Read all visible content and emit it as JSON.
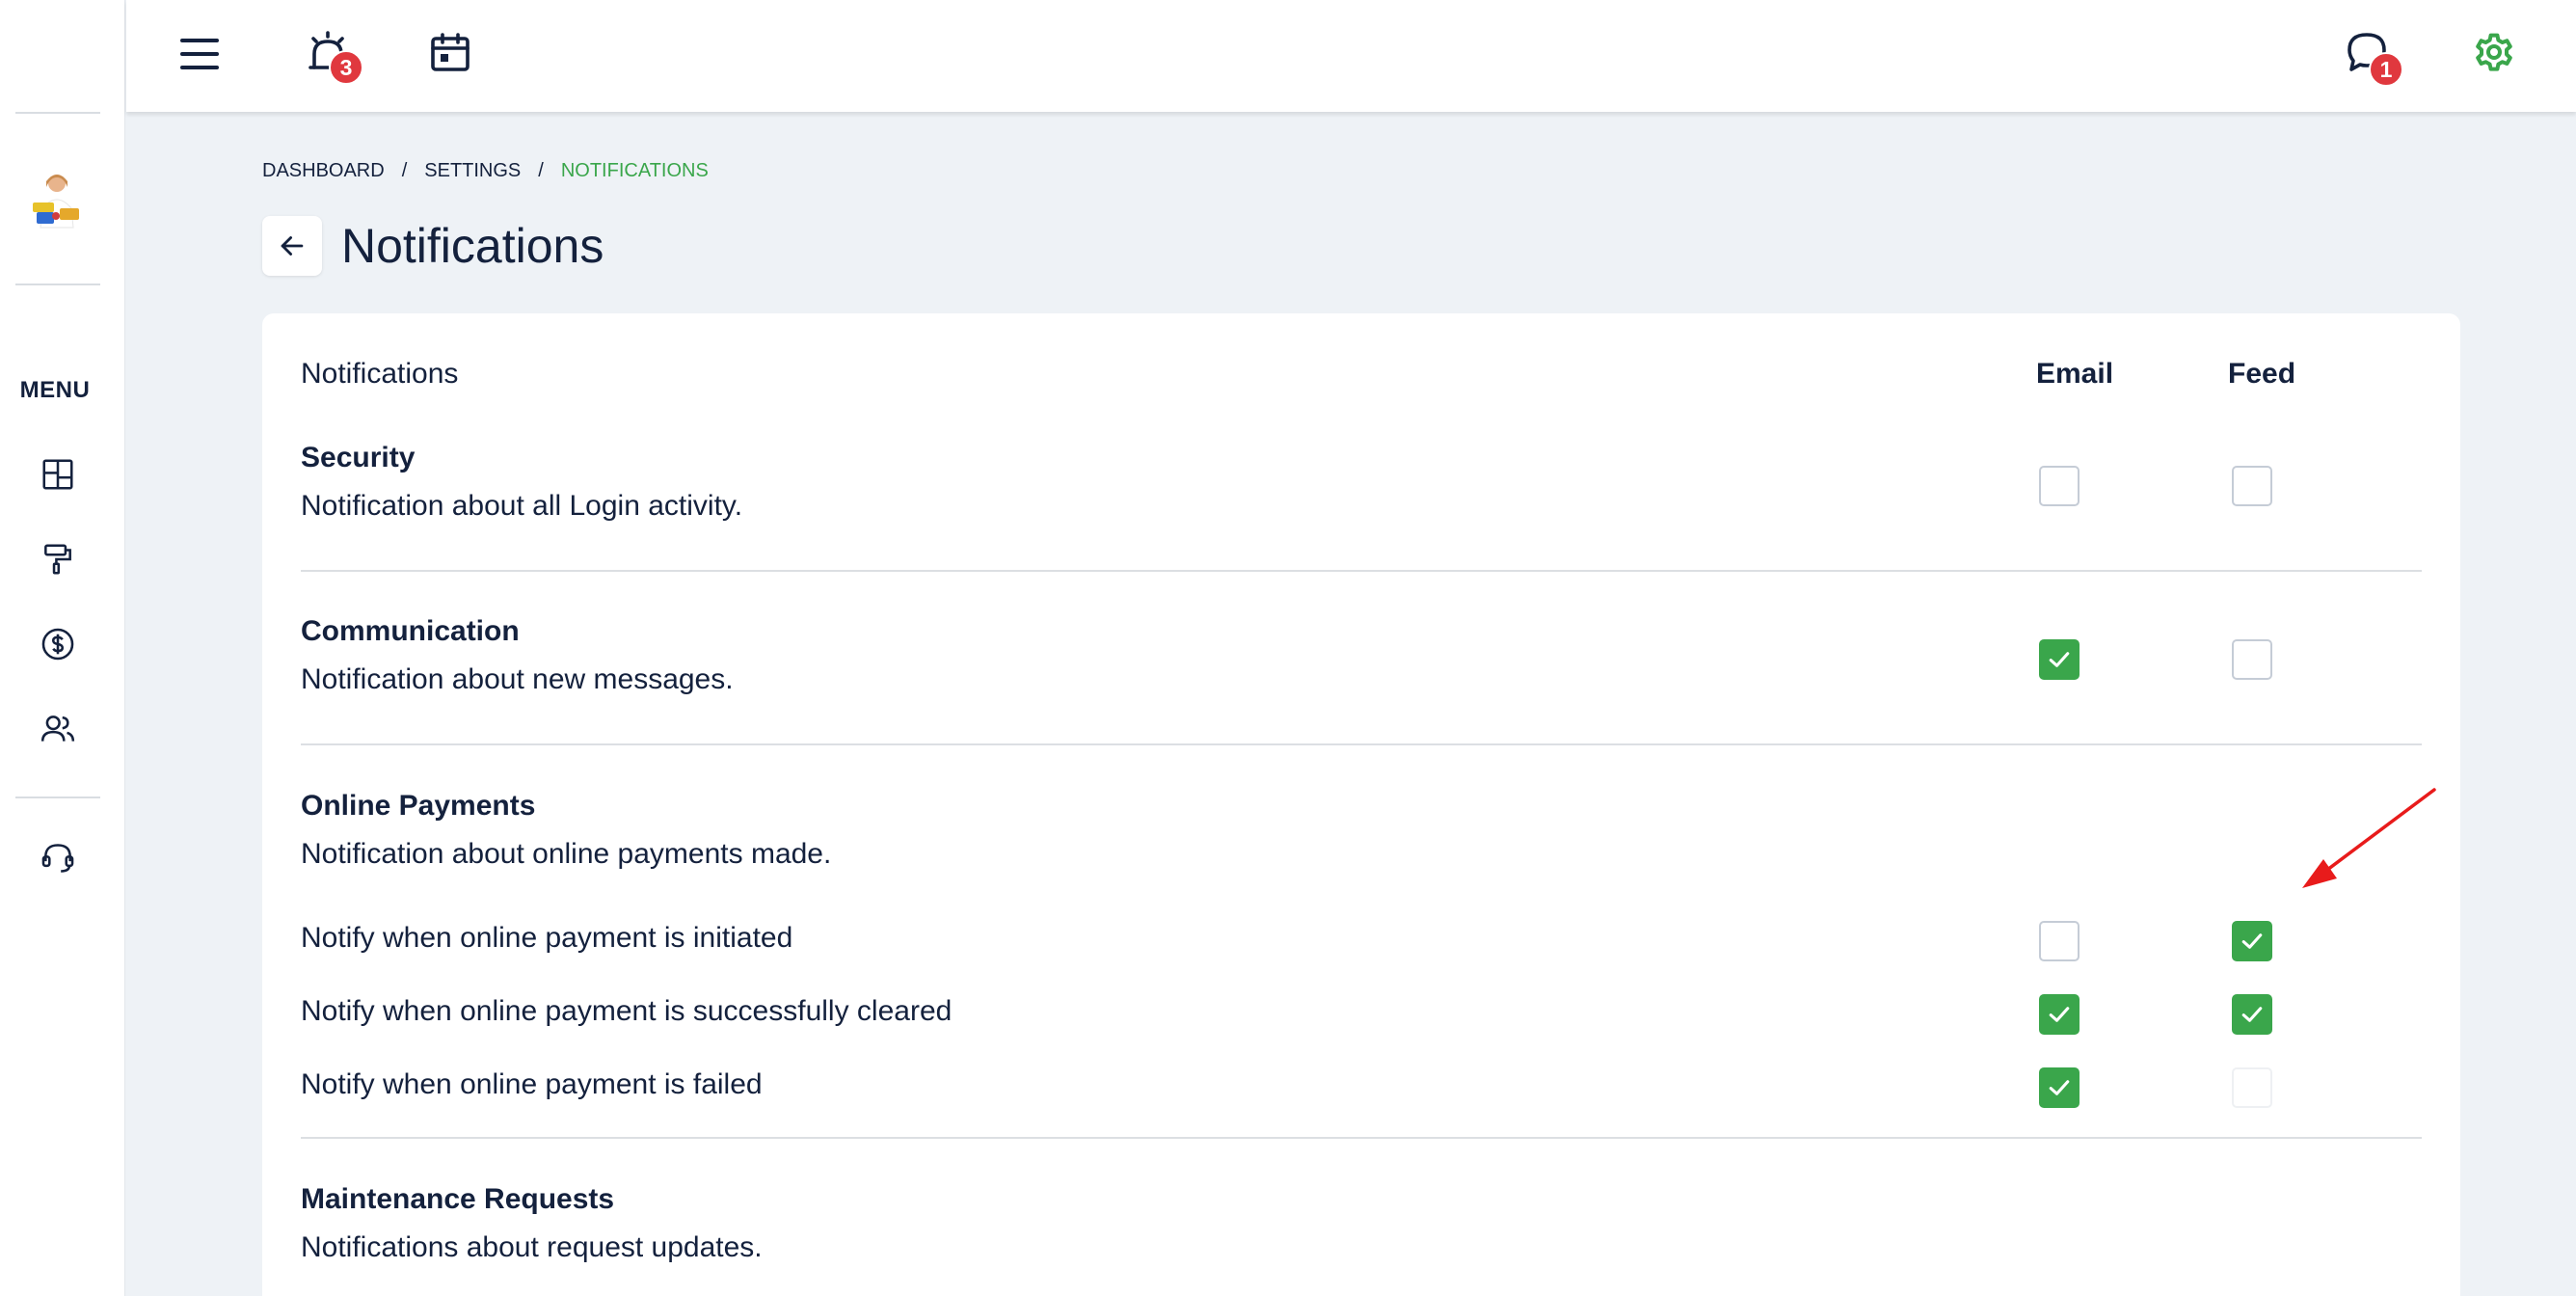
{
  "sidebar": {
    "menu_label": "MENU",
    "items": [
      {
        "name": "dashboard",
        "icon": "dashboard-icon"
      },
      {
        "name": "maintenance",
        "icon": "paint-roller-icon"
      },
      {
        "name": "payments",
        "icon": "dollar-circle-icon"
      },
      {
        "name": "people",
        "icon": "users-icon"
      },
      {
        "name": "support",
        "icon": "headset-icon"
      }
    ]
  },
  "topbar": {
    "alerts_badge": "3",
    "messages_badge": "1",
    "accent_color": "#3aa64b"
  },
  "breadcrumb": {
    "items": [
      "DASHBOARD",
      "SETTINGS",
      "NOTIFICATIONS"
    ],
    "separator": "/"
  },
  "page": {
    "title": "Notifications"
  },
  "card": {
    "header": {
      "label": "Notifications",
      "email": "Email",
      "feed": "Feed"
    },
    "sections": [
      {
        "title": "Security",
        "description": "Notification about all Login activity.",
        "email": false,
        "feed": false
      },
      {
        "title": "Communication",
        "description": "Notification about new messages.",
        "email": true,
        "feed": false
      },
      {
        "title": "Online Payments",
        "description": "Notification about online payments made.",
        "rows": [
          {
            "label": "Notify when online payment is initiated",
            "email": false,
            "feed": true
          },
          {
            "label": "Notify when online payment is successfully cleared",
            "email": true,
            "feed": true
          },
          {
            "label": "Notify when online payment is failed",
            "email": true,
            "feed": false
          }
        ]
      },
      {
        "title": "Maintenance Requests",
        "description": "Notifications about request updates."
      }
    ]
  }
}
